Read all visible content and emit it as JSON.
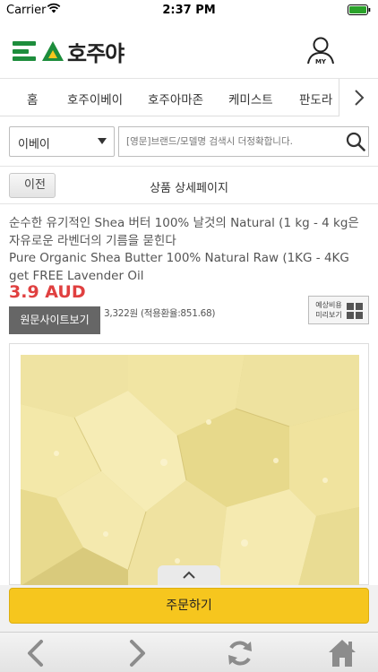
{
  "status_bar": {
    "carrier": "Carrier",
    "time": "2:37 PM"
  },
  "header": {
    "logo_text": "호주야",
    "my_label": "MY",
    "colors": {
      "brand_green": "#1d8d3c",
      "brand_yellow": "#f6c61e"
    }
  },
  "nav": {
    "tabs": [
      "홈",
      "호주이베이",
      "호주아마존",
      "케미스트",
      "판도라"
    ],
    "more_icon": "chevron-right-icon"
  },
  "search": {
    "site_select": "이베이",
    "placeholder": "[영문]브랜드/모델명 검색시 더정확합니다.",
    "icon": "search-icon"
  },
  "page": {
    "back_label": "이전",
    "title": "상품 상세페이지"
  },
  "product": {
    "title_ko": "순수한 유기적인 Shea 버터 100% 날것의 Natural (1 kg - 4 kg은 자유로운 라벤더의 기름을 묻힌다",
    "title_en": "Pure Organic Shea Butter 100% Natural Raw (1KG - 4KG get FREE Lavender Oil",
    "price": "3.9 AUD",
    "original_site_label": "원문사이트보기",
    "krw_price": "3,322원 (적용환율:851.68)",
    "preview_label": "예상비용 미리보기",
    "price_color": "#e04040"
  },
  "order": {
    "button_label": "주문하기"
  },
  "toolbar": {
    "icons": [
      "back-arrow-icon",
      "forward-arrow-icon",
      "refresh-icon",
      "home-icon"
    ]
  }
}
